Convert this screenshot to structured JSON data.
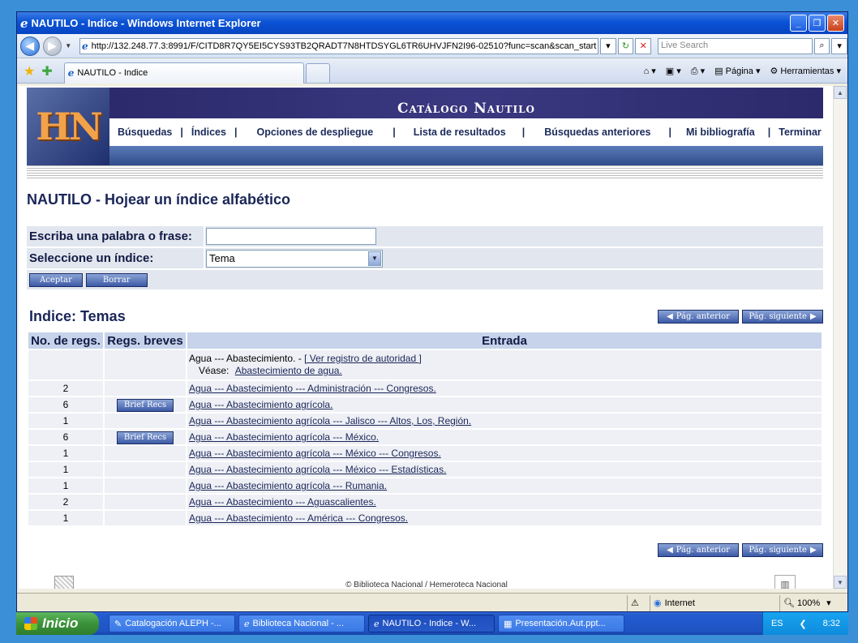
{
  "window": {
    "title": "NAUTILO - Indice - Windows Internet Explorer",
    "address": "http://132.248.77.3:8991/F/CITD8R7QY5EI5CYS93TB2QRADT7N8HTDSYGL6TR6UHVJFN2I96-02510?func=scan&scan_start",
    "search_placeholder": "Live Search",
    "tab_label": "NAUTILO - Indice",
    "cmd_page": "Página",
    "cmd_tools": "Herramientas"
  },
  "banner": {
    "logo_text": "HN",
    "title": "Catálogo Nautilo",
    "nav": [
      "Búsquedas",
      "Índices",
      "Opciones de despliegue",
      "Lista de resultados",
      "Búsquedas anteriores",
      "Mi bibliografía",
      "Terminar"
    ],
    "sep": "|"
  },
  "page_title": "NAUTILO - Hojear un índice alfabético",
  "form": {
    "word_label": "Escriba una palabra o frase:",
    "word_value": "",
    "index_label": "Seleccione un índice:",
    "index_value": "Tema",
    "accept": "Aceptar",
    "clear": "Borrar"
  },
  "index": {
    "title": "Indice: Temas",
    "prev": "Pág. anterior",
    "next": "Pág. siguiente",
    "headers": [
      "No. de regs.",
      "Regs. breves",
      "Entrada"
    ],
    "first_row": {
      "entry": "Agua --- Abastecimiento. - ",
      "authority": "[ Ver registro de autoridad ]",
      "see_label": "Véase:",
      "see_link": "Abastecimiento de agua."
    },
    "brief_label": "Brief Recs",
    "rows": [
      {
        "count": "2",
        "brief": false,
        "entry": "Agua --- Abastecimiento --- Administración --- Congresos."
      },
      {
        "count": "6",
        "brief": true,
        "entry": "Agua --- Abastecimiento agrícola."
      },
      {
        "count": "1",
        "brief": false,
        "entry": "Agua --- Abastecimiento agrícola --- Jalisco --- Altos, Los, Región."
      },
      {
        "count": "6",
        "brief": true,
        "entry": "Agua --- Abastecimiento agrícola --- México."
      },
      {
        "count": "1",
        "brief": false,
        "entry": "Agua --- Abastecimiento agrícola --- México --- Congresos."
      },
      {
        "count": "1",
        "brief": false,
        "entry": "Agua --- Abastecimiento agrícola --- México --- Estadísticas."
      },
      {
        "count": "1",
        "brief": false,
        "entry": "Agua --- Abastecimiento agrícola --- Rumania."
      },
      {
        "count": "2",
        "brief": false,
        "entry": "Agua --- Abastecimiento --- Aguascalientes."
      },
      {
        "count": "1",
        "brief": false,
        "entry": "Agua --- Abastecimiento --- América --- Congresos."
      }
    ]
  },
  "footer": {
    "copyright": "© Biblioteca Nacional / Hemeroteca Nacional"
  },
  "statusbar": {
    "zone": "Internet",
    "zoom": "100%"
  },
  "taskbar": {
    "start": "Inicio",
    "items": [
      "Catalogación ALEPH -...",
      "Biblioteca Nacional - ...",
      "NAUTILO - Indice - W...",
      "Presentación.Aut.ppt..."
    ],
    "lang": "ES",
    "time": "8:32"
  }
}
